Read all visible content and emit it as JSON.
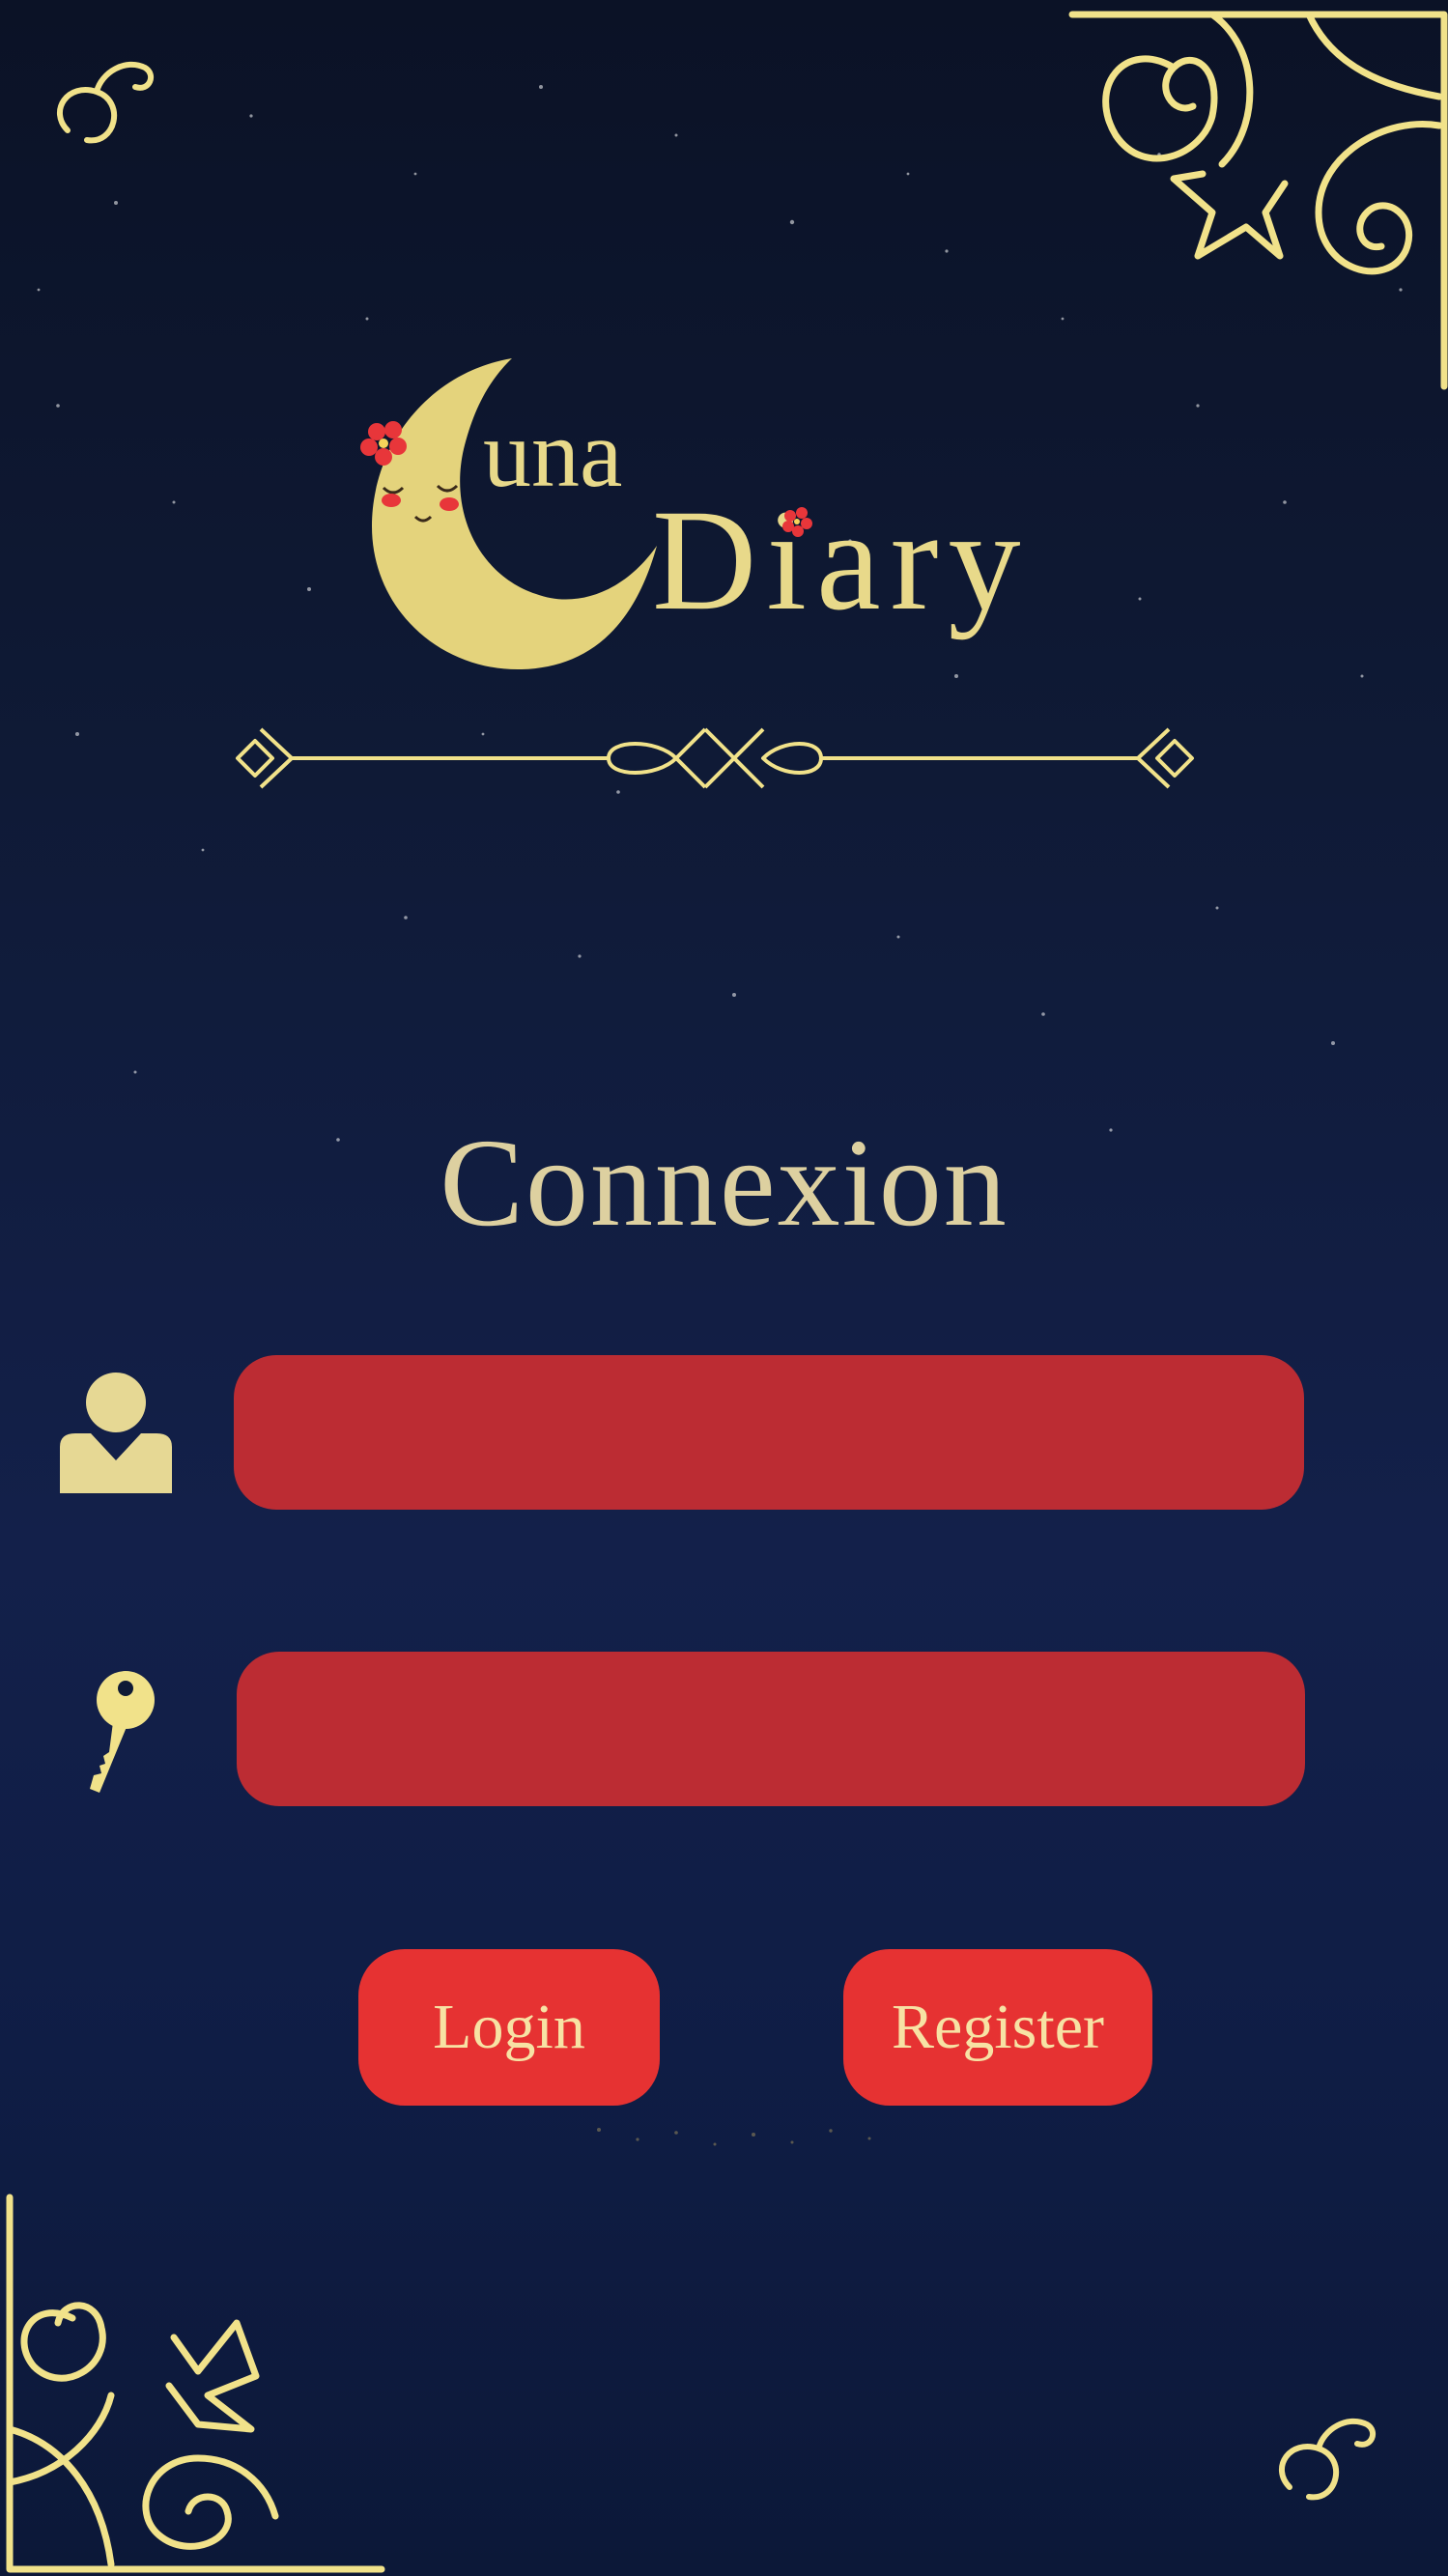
{
  "app": {
    "logo_line1": "una",
    "logo_line2": "Diary"
  },
  "page": {
    "title": "Connexion"
  },
  "form": {
    "username": {
      "icon": "user-icon",
      "value": "",
      "placeholder": ""
    },
    "password": {
      "icon": "key-icon",
      "value": "",
      "placeholder": ""
    }
  },
  "buttons": {
    "login": "Login",
    "register": "Register"
  },
  "colors": {
    "background": "#0f1a36",
    "gold": "#f1e28a",
    "field": "#bc2c33",
    "button": "#e63232",
    "button_text": "#f7e2a4",
    "title_text": "#ddd0a0"
  }
}
